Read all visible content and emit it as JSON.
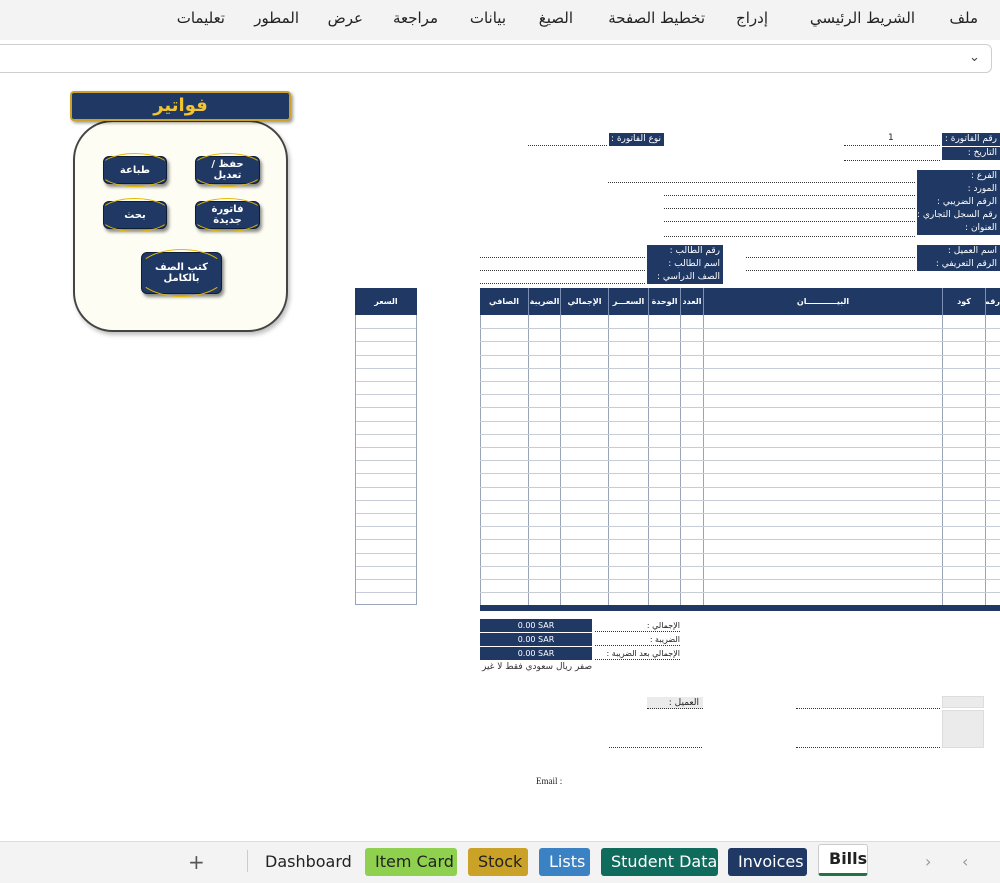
{
  "ribbon": {
    "items": [
      "ملف",
      "الشريط الرئيسي",
      "إدراج",
      "تخطيط الصفحة",
      "الصيغ",
      "بيانات",
      "مراجعة",
      "عرض",
      "المطور",
      "تعليمات"
    ]
  },
  "panel": {
    "title": "فواتير",
    "buttons": {
      "save": "حفظ / تعديل",
      "print": "طباعة",
      "new": "فاتورة جديدة",
      "search": "بحث",
      "class_book": "كتب الصف بالكامل"
    }
  },
  "header": {
    "invoice_no_label": "رقم الفاتورة :",
    "invoice_no_value": "1",
    "date_label": "التاريخ :",
    "invoice_type_label": "نوع الفاتورة :",
    "branch_label": "الفرع :",
    "supplier_label": "المورد :",
    "tax_no_label": "الرقم الضريبي :",
    "cr_no_label": "رقم السجل التجاري :",
    "address_label": "العنوان :",
    "customer_name_label": "اسم العميل :",
    "id_no_label": "الرقم التعريفي :",
    "student_no_label": "رقم الطالب :",
    "student_name_label": "اسم الطالب :",
    "grade_label": "الصف الدراسي :"
  },
  "table": {
    "columns": [
      "رقم",
      "كود",
      "البيـــــــــــان",
      "العدد",
      "الوحدة",
      "السعـــر",
      "الإجمالي",
      "الضريبة",
      "الصافي"
    ],
    "price_column": "السعر"
  },
  "totals": {
    "total_label": "الإجمالي :",
    "total_value": "0.00 SAR",
    "tax_label": "الضريبة :",
    "tax_value": "0.00 SAR",
    "grand_label": "الإجمالي بعد الضريبة :",
    "grand_value": "0.00 SAR",
    "in_words": "صفر ريال سعودي فقط لا غير"
  },
  "footer": {
    "customer_label": "العميل :",
    "email_label": "Email :"
  },
  "tabs": {
    "add": "+",
    "items": [
      "Dashboard",
      "Item Card",
      "Stock",
      "Lists",
      "Student Data",
      "Invoices",
      "Bills"
    ],
    "colors": {
      "Item Card": "#8fd14f",
      "Stock": "#c9a227",
      "Lists": "#3b82c4",
      "Student Data": "#0f6b5c",
      "Invoices": "#1f3864"
    },
    "active": "Bills"
  }
}
